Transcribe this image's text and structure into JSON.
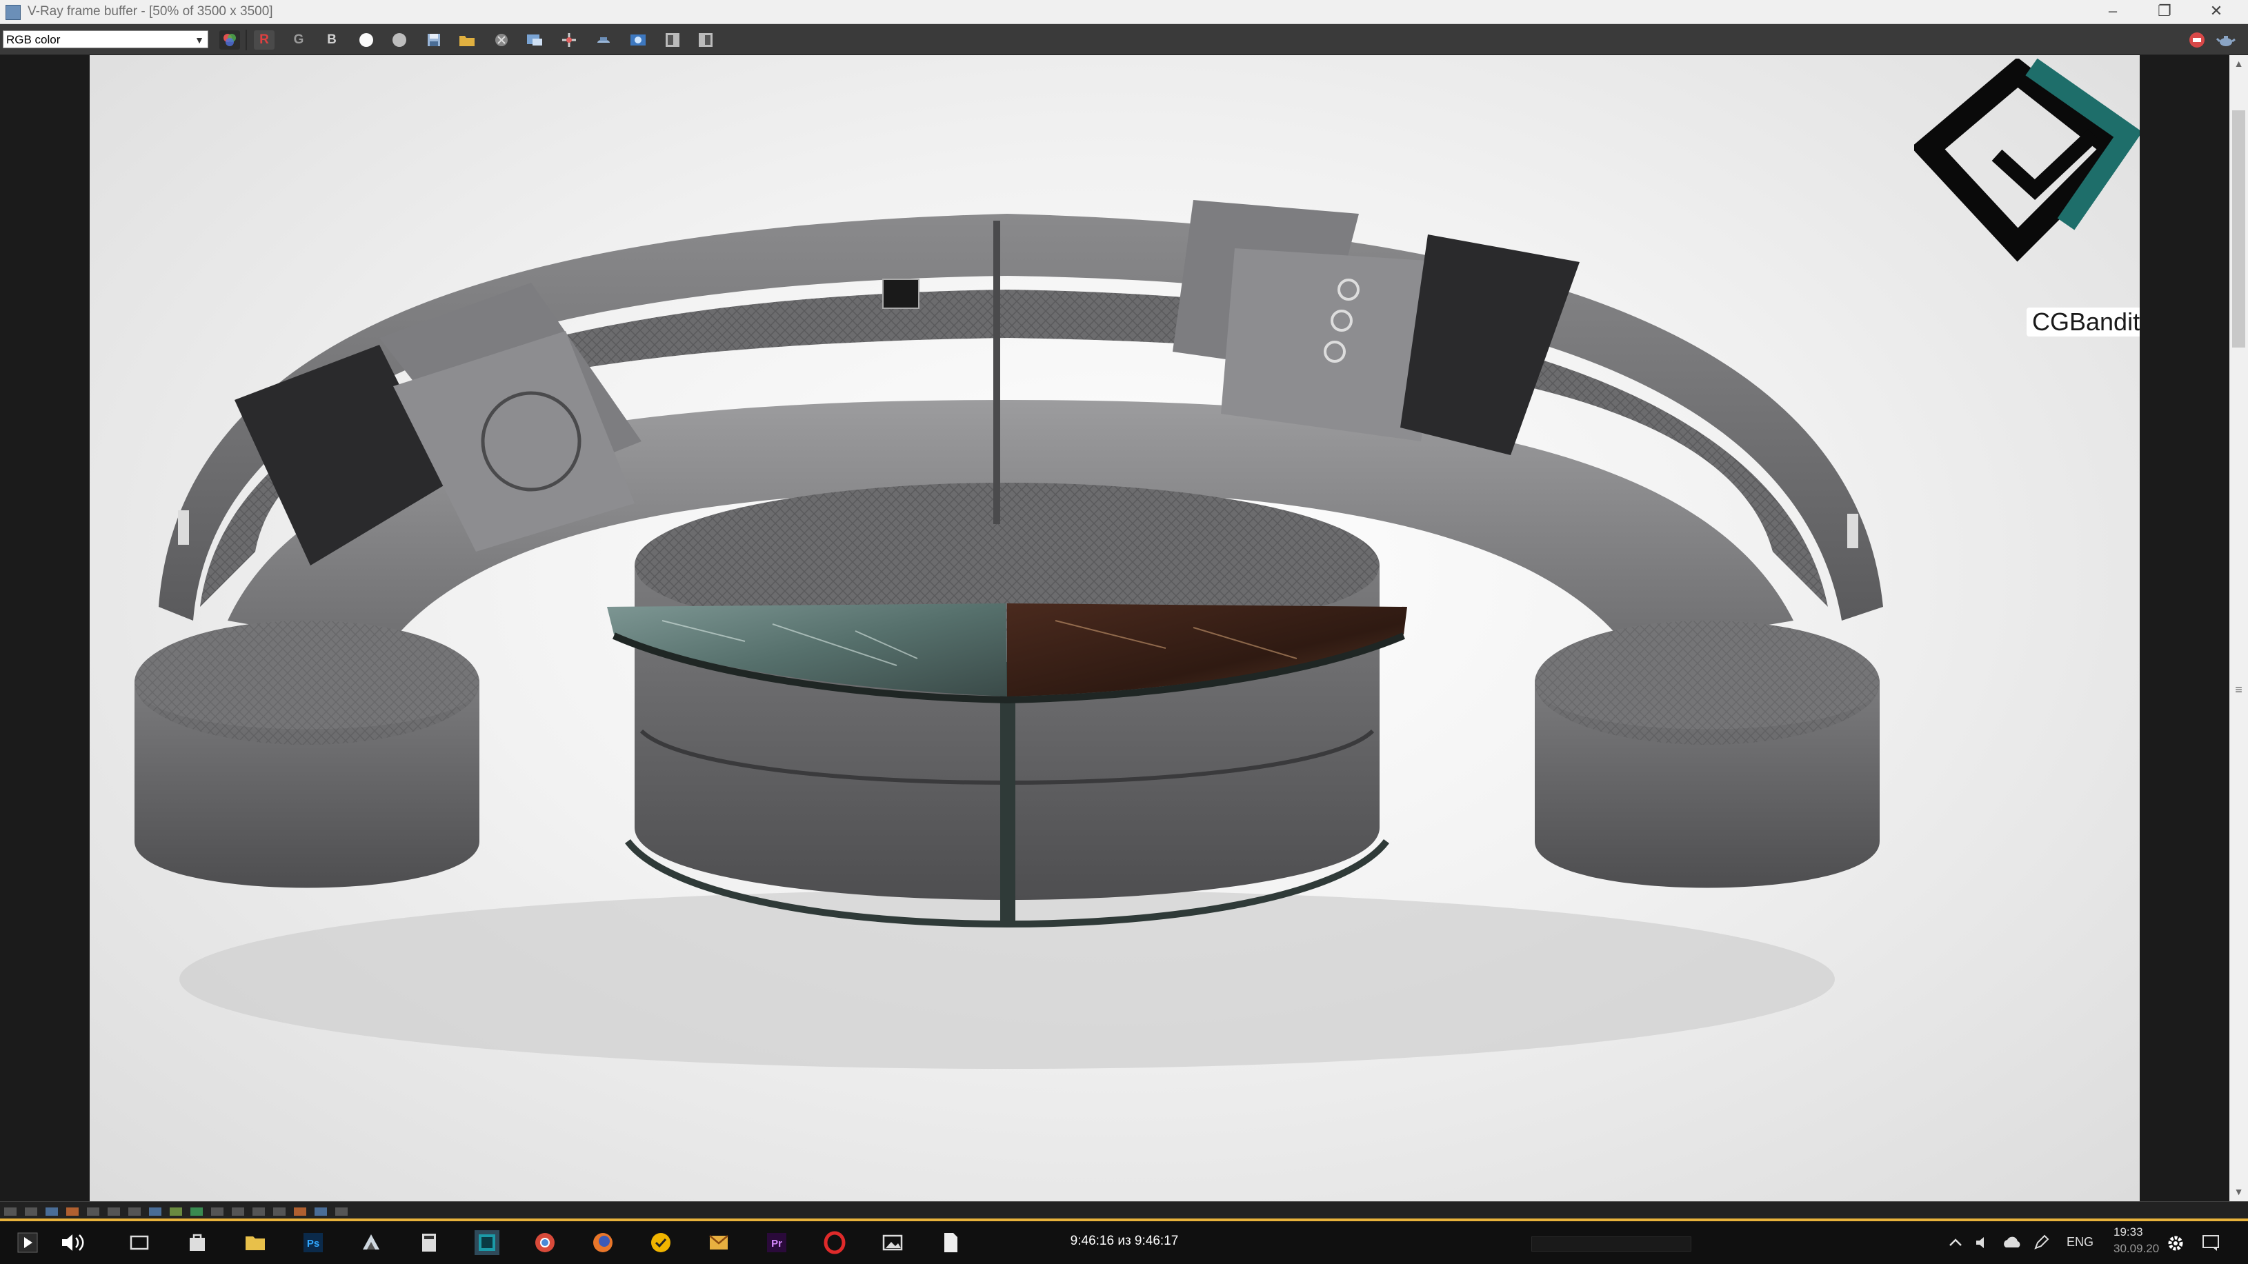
{
  "window": {
    "title": "V-Ray frame buffer - [50% of 3500 x 3500]",
    "minimize_icon": "minimize-icon",
    "restore_icon": "restore-icon",
    "close_icon": "close-icon"
  },
  "toolbar": {
    "channel_select": {
      "value": "RGB color"
    },
    "channel_buttons": [
      {
        "label": "R",
        "color": "#e04040"
      },
      {
        "label": "G",
        "color": "#9a9a9a"
      },
      {
        "label": "B",
        "color": "#cfcfcf"
      }
    ],
    "tools": [
      "color-wheel-icon",
      "white-circle-icon",
      "grey-circle-icon",
      "save-icon",
      "open-folder-icon",
      "clear-icon",
      "region-render-icon",
      "track-mouse-icon",
      "render-last-icon",
      "lens-effects-icon",
      "compare-a-icon",
      "compare-b-icon",
      "stop-render-icon",
      "teapot-icon"
    ]
  },
  "render": {
    "watermark_text": "CGBandit.com",
    "colors": {
      "logo_dark": "#0a0a0a",
      "logo_teal": "#1e6e6a"
    }
  },
  "player": {
    "time_readout": "9:46:16 из 9:46:17",
    "progress": 0.9999,
    "accent": "#e8b33c"
  },
  "taskbar": {
    "apps": [
      "start-icon",
      "volume-icon",
      "task-view-icon",
      "store-icon",
      "file-explorer-icon",
      "photoshop-icon",
      "3dsmax-icon",
      "calculator-icon",
      "terminal-icon",
      "chrome-icon",
      "firefox-icon",
      "norton-icon",
      "gmail-icon",
      "premiere-icon",
      "opera-icon",
      "photos-icon",
      "document-icon"
    ],
    "tray": {
      "language": "ENG",
      "clock_time": "19:33",
      "clock_date": "30.09.20"
    }
  }
}
